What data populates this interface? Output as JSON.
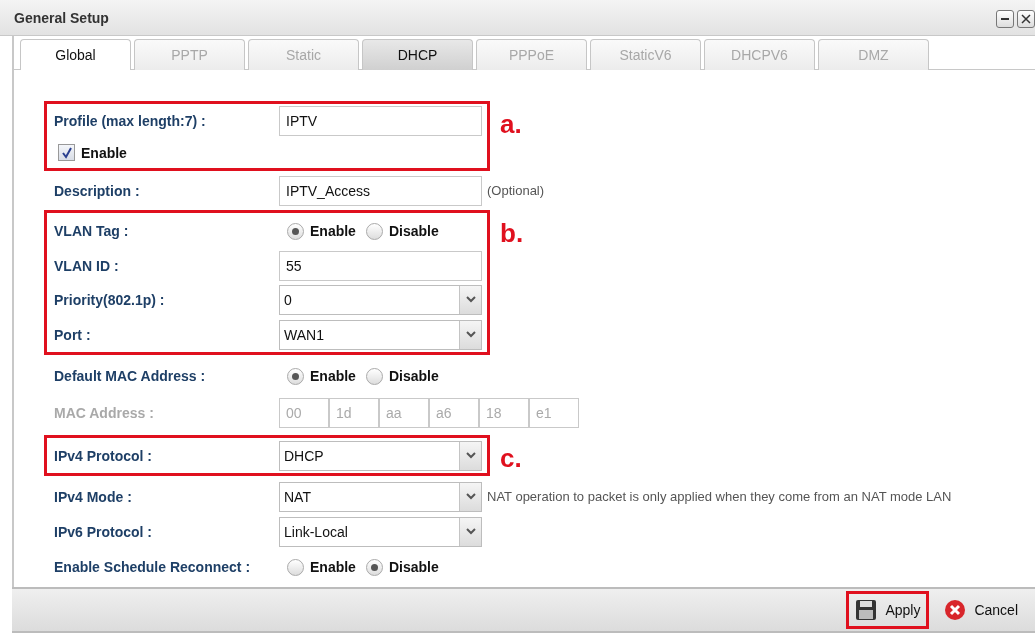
{
  "window": {
    "title": "General Setup"
  },
  "tabs": [
    {
      "label": "Global",
      "selected": true,
      "disabled": false
    },
    {
      "label": "PPTP",
      "selected": false,
      "disabled": true
    },
    {
      "label": "Static",
      "selected": false,
      "disabled": true
    },
    {
      "label": "DHCP",
      "selected": false,
      "disabled": false
    },
    {
      "label": "PPPoE",
      "selected": false,
      "disabled": true
    },
    {
      "label": "StaticV6",
      "selected": false,
      "disabled": true
    },
    {
      "label": "DHCPV6",
      "selected": false,
      "disabled": true
    },
    {
      "label": "DMZ",
      "selected": false,
      "disabled": true
    }
  ],
  "sections": [
    {
      "marker": "a.",
      "rows": [
        {
          "kind": "text",
          "label": "Profile (max length:7) :",
          "value": "IPTV"
        },
        {
          "kind": "checkbox",
          "label": "Enable",
          "checked": true
        }
      ]
    },
    {
      "rows": [
        {
          "kind": "text",
          "label": "Description :",
          "value": "IPTV_Access",
          "note": "(Optional)"
        }
      ]
    },
    {
      "marker": "b.",
      "rows": [
        {
          "kind": "radio",
          "label": "VLAN Tag :",
          "options": [
            {
              "label": "Enable",
              "selected": true
            },
            {
              "label": "Disable",
              "selected": false
            }
          ]
        },
        {
          "kind": "text",
          "label": "VLAN ID :",
          "value": "55"
        },
        {
          "kind": "select",
          "label": "Priority(802.1p) :",
          "value": "0"
        },
        {
          "kind": "select",
          "label": "Port :",
          "value": "WAN1"
        }
      ]
    },
    {
      "rows": [
        {
          "kind": "radio",
          "label": "Default MAC Address :",
          "options": [
            {
              "label": "Enable",
              "selected": true
            },
            {
              "label": "Disable",
              "selected": false
            }
          ]
        },
        {
          "kind": "mac",
          "label": "MAC Address :",
          "disabled": true,
          "octets": [
            "00",
            "1d",
            "aa",
            "a6",
            "18",
            "e1"
          ]
        }
      ]
    },
    {
      "marker": "c.",
      "rows": [
        {
          "kind": "select",
          "label": "IPv4 Protocol :",
          "value": "DHCP"
        }
      ]
    },
    {
      "rows": [
        {
          "kind": "select",
          "label": "IPv4 Mode :",
          "value": "NAT",
          "note": "NAT operation to packet is only applied when they come from an NAT mode LAN"
        },
        {
          "kind": "select",
          "label": "IPv6 Protocol :",
          "value": "Link-Local"
        },
        {
          "kind": "radio",
          "label": "Enable Schedule Reconnect :",
          "options": [
            {
              "label": "Enable",
              "selected": false
            },
            {
              "label": "Disable",
              "selected": true
            }
          ]
        }
      ]
    }
  ],
  "footer": {
    "buttons": [
      {
        "kind": "apply",
        "label": "Apply",
        "highlighted": true
      },
      {
        "kind": "cancel",
        "label": "Cancel",
        "highlighted": false
      }
    ]
  }
}
